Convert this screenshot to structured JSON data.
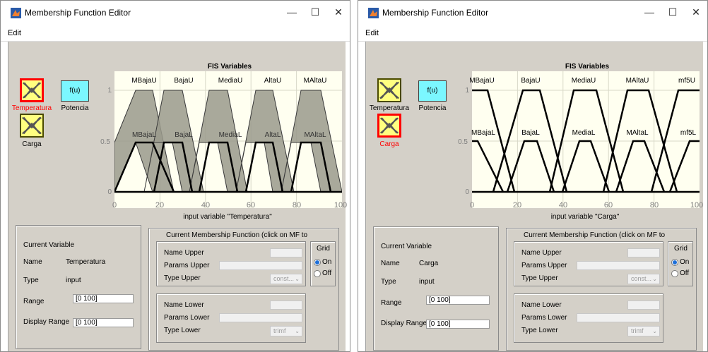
{
  "windows": [
    {
      "title": "Membership Function Editor",
      "menu": "Edit",
      "variables": [
        {
          "label": "Temperatura",
          "selected": true,
          "icon": "mf-triangles-icon"
        },
        {
          "label": "Potencia",
          "selected": false,
          "icon": "fu-icon",
          "fu": "f(u)"
        },
        {
          "label": "Carga",
          "selected": false,
          "icon": "mf-triangles-icon"
        }
      ],
      "plot": {
        "title": "FIS Variables",
        "xlabel": "input variable \"Temperatura\"",
        "xticks": [
          "0",
          "20",
          "40",
          "60",
          "80",
          "100"
        ],
        "yticks": [
          "1",
          "0.5",
          "0"
        ],
        "upper_labels": [
          "MBajaU",
          "BajaU",
          "MediaU",
          "AltaU",
          "MAltaU"
        ],
        "lower_labels": [
          "MBajaL",
          "BajaL",
          "MediaL",
          "AltaL",
          "MAltaL"
        ],
        "mf_fill": "#9a9a8c"
      },
      "current_variable": {
        "heading": "Current Variable",
        "name_label": "Name",
        "name": "Temperatura",
        "type_label": "Type",
        "type": "input",
        "range_label": "Range",
        "range": "[0 100]",
        "display_range_label": "Display Range",
        "display_range": "[0 100]"
      },
      "current_mf": {
        "heading": "Current Membership Function (click on MF to",
        "name_upper": "Name Upper",
        "params_upper": "Params Upper",
        "type_upper": "Type Upper",
        "type_upper_value": "const...",
        "name_lower": "Name Lower",
        "params_lower": "Params Lower",
        "type_lower": "Type Lower",
        "type_lower_value": "trimf"
      },
      "grid": {
        "heading": "Grid",
        "on": "On",
        "off": "Off",
        "value": "On"
      }
    },
    {
      "title": "Membership Function Editor",
      "menu": "Edit",
      "variables": [
        {
          "label": "Temperatura",
          "selected": false,
          "icon": "mf-triangles-icon"
        },
        {
          "label": "Potencia",
          "selected": false,
          "icon": "fu-icon",
          "fu": "f(u)"
        },
        {
          "label": "Carga",
          "selected": true,
          "icon": "mf-triangles-icon"
        }
      ],
      "plot": {
        "title": "FIS Variables",
        "xlabel": "input variable \"Carga\"",
        "xticks": [
          "0",
          "20",
          "40",
          "60",
          "80",
          "100"
        ],
        "yticks": [
          "1",
          "0.5",
          "0"
        ],
        "upper_labels": [
          "MBajaU",
          "BajaU",
          "MediaU",
          "MAltaU",
          "mf5U"
        ],
        "lower_labels": [
          "MBajaL",
          "BajaL",
          "MediaL",
          "MAltaL",
          "mf5L"
        ]
      },
      "current_variable": {
        "heading": "Current Variable",
        "name_label": "Name",
        "name": "Carga",
        "type_label": "Type",
        "type": "input",
        "range_label": "Range",
        "range": "[0 100]",
        "display_range_label": "Display Range",
        "display_range": "[0 100]"
      },
      "current_mf": {
        "heading": "Current Membership Function (click on MF to",
        "name_upper": "Name Upper",
        "params_upper": "Params Upper",
        "type_upper": "Type Upper",
        "type_upper_value": "const...",
        "name_lower": "Name Lower",
        "params_lower": "Params Lower",
        "type_lower": "Type Lower",
        "type_lower_value": "trimf"
      },
      "grid": {
        "heading": "Grid",
        "on": "On",
        "off": "Off",
        "value": "On"
      }
    }
  ]
}
